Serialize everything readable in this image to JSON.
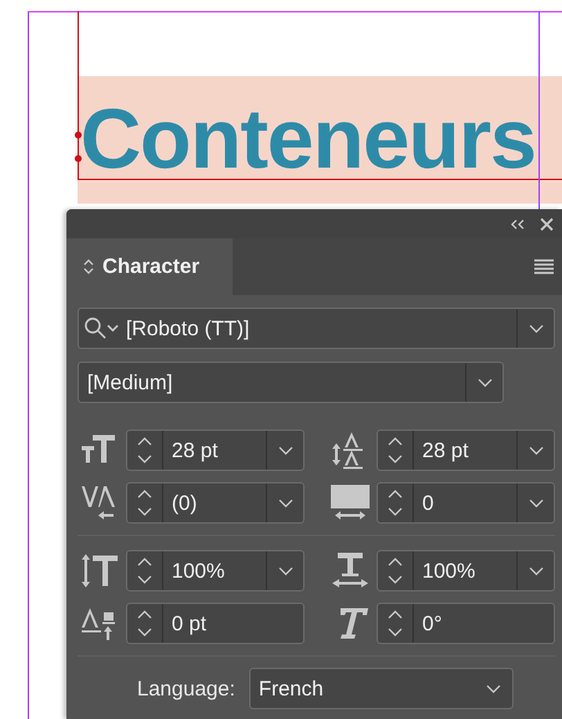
{
  "canvas": {
    "heading": "Conteneurs"
  },
  "panel": {
    "tabs": [
      {
        "label": "Character",
        "selected": true
      }
    ],
    "font_family": {
      "value": "[Roboto (TT)]"
    },
    "font_style": {
      "value": "[Medium]"
    },
    "metric_groups": [
      [
        {
          "kind": "size",
          "value": "28 pt",
          "dropdown": true
        },
        {
          "kind": "leading",
          "value": "28 pt",
          "dropdown": true
        },
        {
          "kind": "kerning",
          "value": "(0)",
          "dropdown": true
        },
        {
          "kind": "tracking",
          "value": "0",
          "dropdown": true
        }
      ],
      [
        {
          "kind": "vscale",
          "value": "100%",
          "dropdown": true
        },
        {
          "kind": "hscale",
          "value": "100%",
          "dropdown": true
        },
        {
          "kind": "baseline",
          "value": "0 pt",
          "dropdown": false
        },
        {
          "kind": "skew",
          "value": "0°",
          "dropdown": false
        }
      ]
    ],
    "language": {
      "label": "Language:",
      "value": "French"
    }
  }
}
